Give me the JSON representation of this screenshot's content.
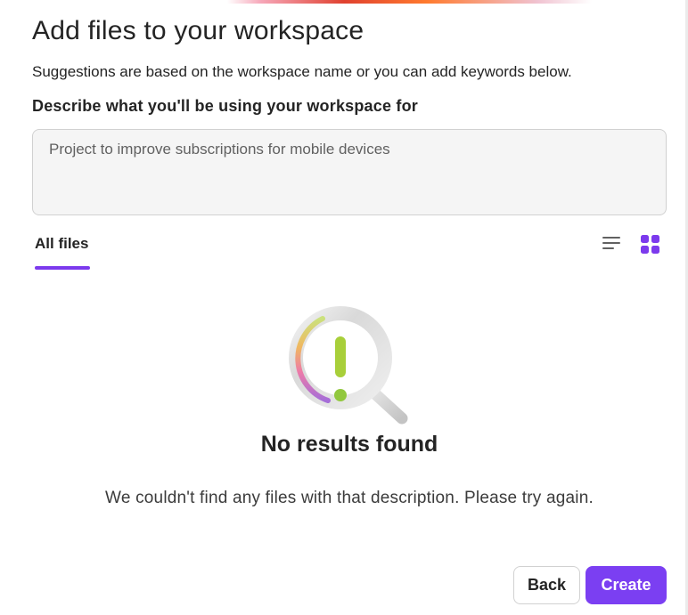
{
  "dialog": {
    "title": "Add files to your workspace",
    "subtitle": "Suggestions are based on the workspace name or you can add keywords below.",
    "field_label": "Describe what you'll be using your workspace for",
    "description_placeholder": "Project to improve subscriptions for mobile devices",
    "description_value": ""
  },
  "tabs": {
    "items": [
      {
        "label": "All files",
        "selected": true
      }
    ]
  },
  "view_toggle": {
    "list_icon": "list-view-icon",
    "grid_icon": "grid-view-icon",
    "selected": "grid"
  },
  "empty_state": {
    "icon": "no-results-magnifier-icon",
    "title": "No results found",
    "message": "We couldn't find any files with that description. Please try again."
  },
  "footer": {
    "back_label": "Back",
    "create_label": "Create"
  },
  "colors": {
    "accent": "#7b3ff2",
    "text_primary": "#242424",
    "input_background": "#f5f5f5"
  }
}
